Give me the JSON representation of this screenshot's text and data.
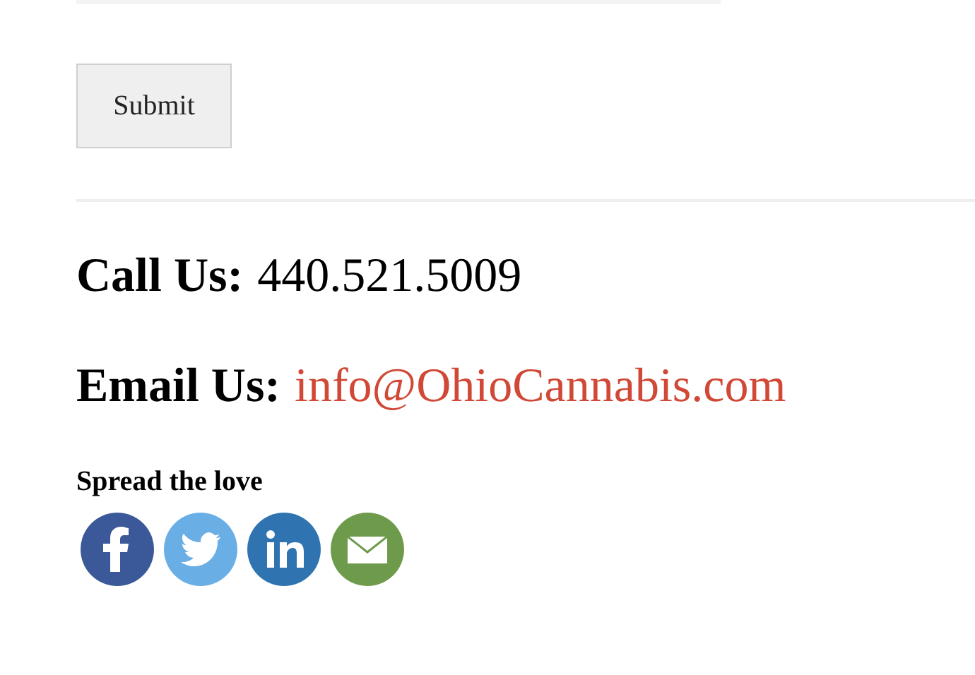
{
  "form": {
    "submit_label": "Submit"
  },
  "contact": [
    {
      "kind": "phone",
      "label": "Call Us:",
      "value": "440.521.5009"
    },
    {
      "kind": "email",
      "label": "Email Us:",
      "value": "info@OhioCannabis.com"
    }
  ],
  "share": {
    "heading": "Spread the love",
    "buttons": [
      {
        "kind": "facebook",
        "color": "#3b5998"
      },
      {
        "kind": "twitter",
        "color": "#6aaee6"
      },
      {
        "kind": "linkedin",
        "color": "#2f74b1"
      },
      {
        "kind": "email",
        "color": "#6d9a4b"
      }
    ]
  }
}
